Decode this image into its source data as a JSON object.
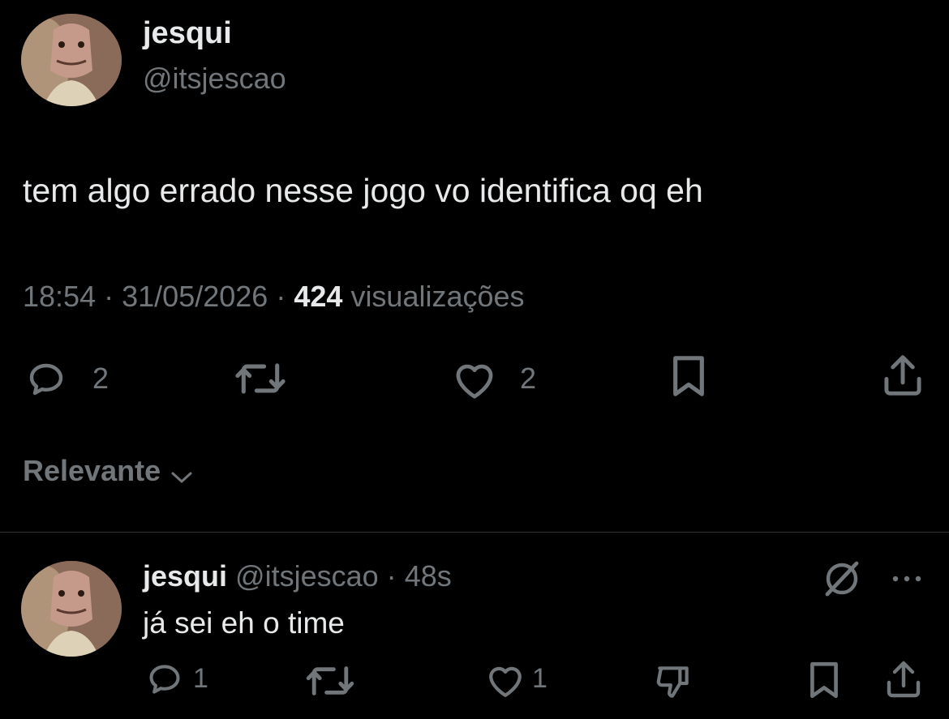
{
  "post": {
    "display_name": "jesqui",
    "handle": "@itsjescao",
    "text": "tem algo errado nesse jogo vo identifica oq eh",
    "time": "18:54",
    "date": "31/05/2026",
    "views_count": "424",
    "views_label": "visualizações",
    "sep": "·",
    "actions": {
      "reply_count": "2",
      "like_count": "2"
    }
  },
  "sort": {
    "label": "Relevante"
  },
  "reply": {
    "display_name": "jesqui",
    "handle": "@itsjescao",
    "time_ago": "48s",
    "sep": "·",
    "text": "já sei eh o time",
    "actions": {
      "reply_count": "1",
      "like_count": "1"
    }
  },
  "icons": {
    "reply": "speech-bubble-icon",
    "repost": "repost-arrows-icon",
    "like": "heart-icon",
    "bookmark": "bookmark-icon",
    "share": "share-upload-icon",
    "dislike": "thumbs-down-icon",
    "grok": "slashed-circle-icon",
    "more": "more-dots-icon",
    "chevron": "chevron-down-icon"
  },
  "colors": {
    "background": "#000000",
    "text": "#e7e9ea",
    "muted": "#71767b",
    "divider": "#2f3336"
  }
}
